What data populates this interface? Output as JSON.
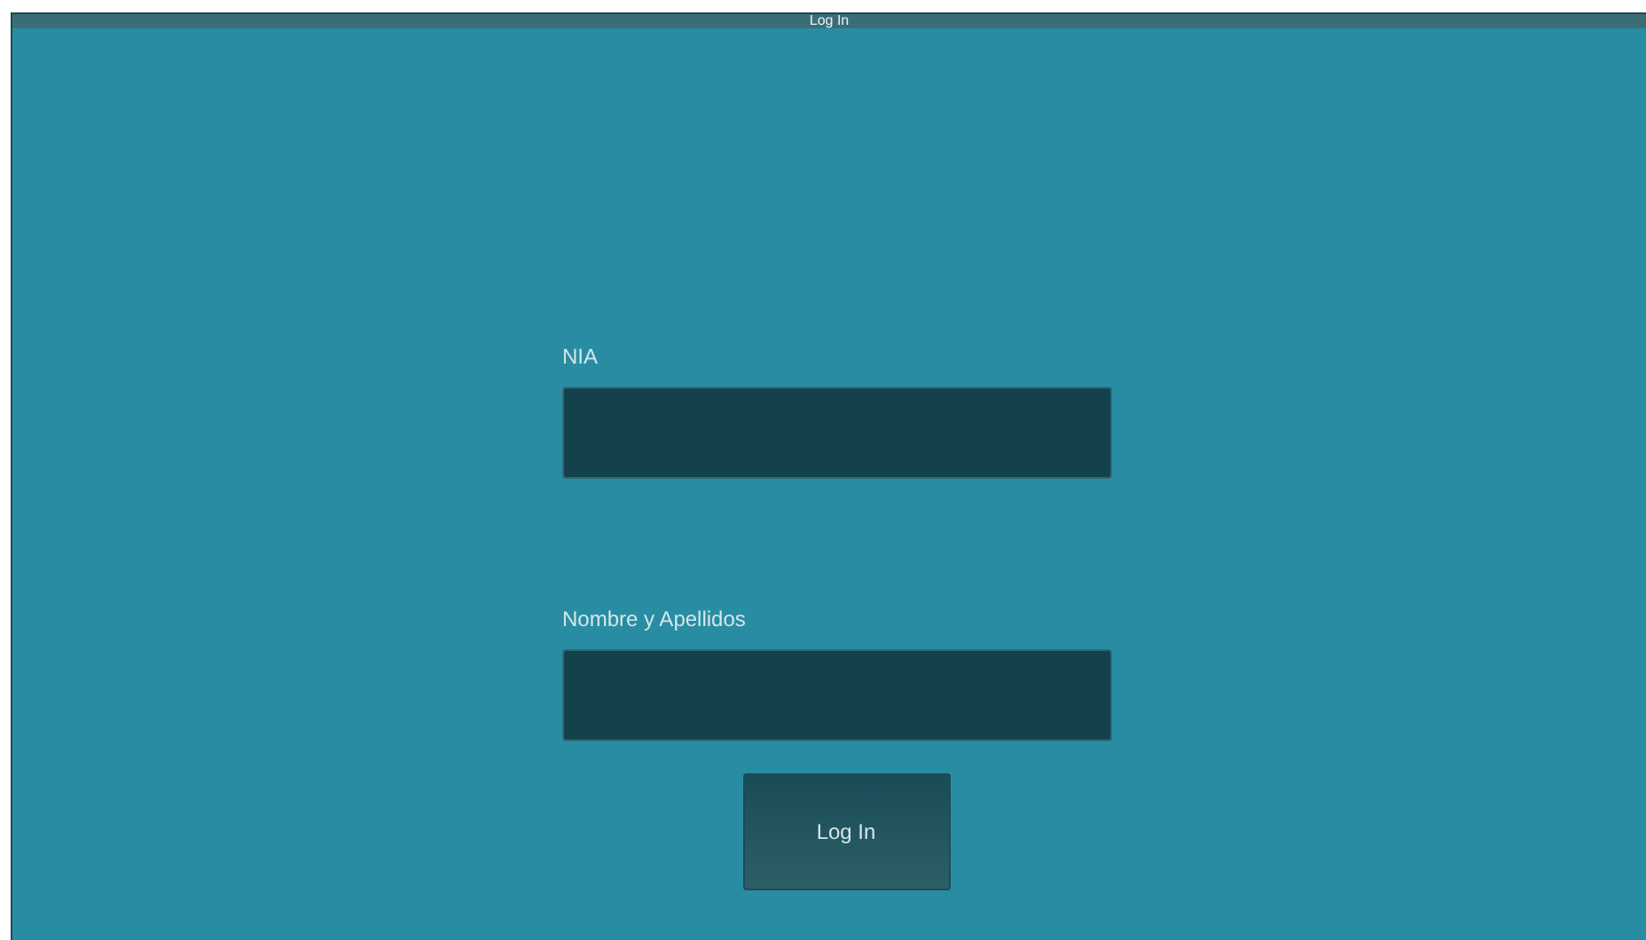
{
  "window": {
    "title": "Log In"
  },
  "fields": [
    {
      "label": "NIA"
    },
    {
      "label": "Nombre y Apellidos"
    }
  ],
  "button": {
    "label": "Log In"
  }
}
